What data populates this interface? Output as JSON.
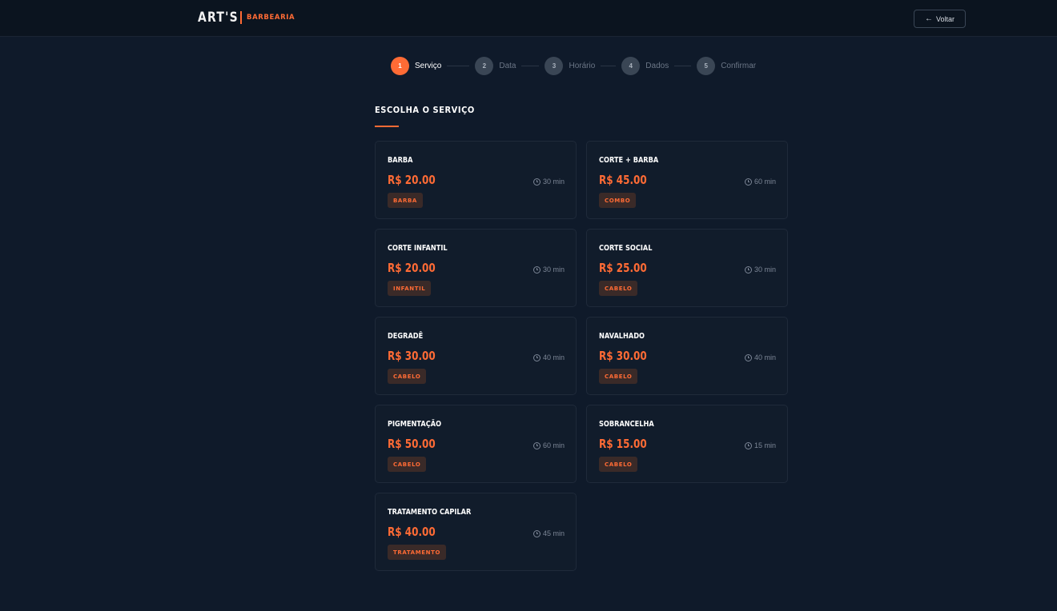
{
  "header": {
    "brand_name": "ART'S",
    "brand_sub": "BARBEARIA",
    "back_label": "Voltar",
    "back_icon": "arrow-left-icon"
  },
  "colors": {
    "accent": "#ff6b35",
    "background": "#0f1a2a",
    "card": "#111c2b"
  },
  "stepper": {
    "active_index": 0,
    "steps": [
      {
        "number": "1",
        "label": "Serviço"
      },
      {
        "number": "2",
        "label": "Data"
      },
      {
        "number": "3",
        "label": "Horário"
      },
      {
        "number": "4",
        "label": "Dados"
      },
      {
        "number": "5",
        "label": "Confirmar"
      }
    ]
  },
  "section": {
    "title": "ESCOLHA O SERVIÇO"
  },
  "services": [
    {
      "name": "BARBA",
      "price": "R$ 20.00",
      "duration": "30 min",
      "tag": "BARBA"
    },
    {
      "name": "CORTE + BARBA",
      "price": "R$ 45.00",
      "duration": "60 min",
      "tag": "COMBO"
    },
    {
      "name": "CORTE INFANTIL",
      "price": "R$ 20.00",
      "duration": "30 min",
      "tag": "INFANTIL"
    },
    {
      "name": "CORTE SOCIAL",
      "price": "R$ 25.00",
      "duration": "30 min",
      "tag": "CABELO"
    },
    {
      "name": "DEGRADÊ",
      "price": "R$ 30.00",
      "duration": "40 min",
      "tag": "CABELO"
    },
    {
      "name": "NAVALHADO",
      "price": "R$ 30.00",
      "duration": "40 min",
      "tag": "CABELO"
    },
    {
      "name": "PIGMENTAÇÃO",
      "price": "R$ 50.00",
      "duration": "60 min",
      "tag": "CABELO"
    },
    {
      "name": "SOBRANCELHA",
      "price": "R$ 15.00",
      "duration": "15 min",
      "tag": "CABELO"
    },
    {
      "name": "TRATAMENTO CAPILAR",
      "price": "R$ 40.00",
      "duration": "45 min",
      "tag": "TRATAMENTO"
    }
  ]
}
